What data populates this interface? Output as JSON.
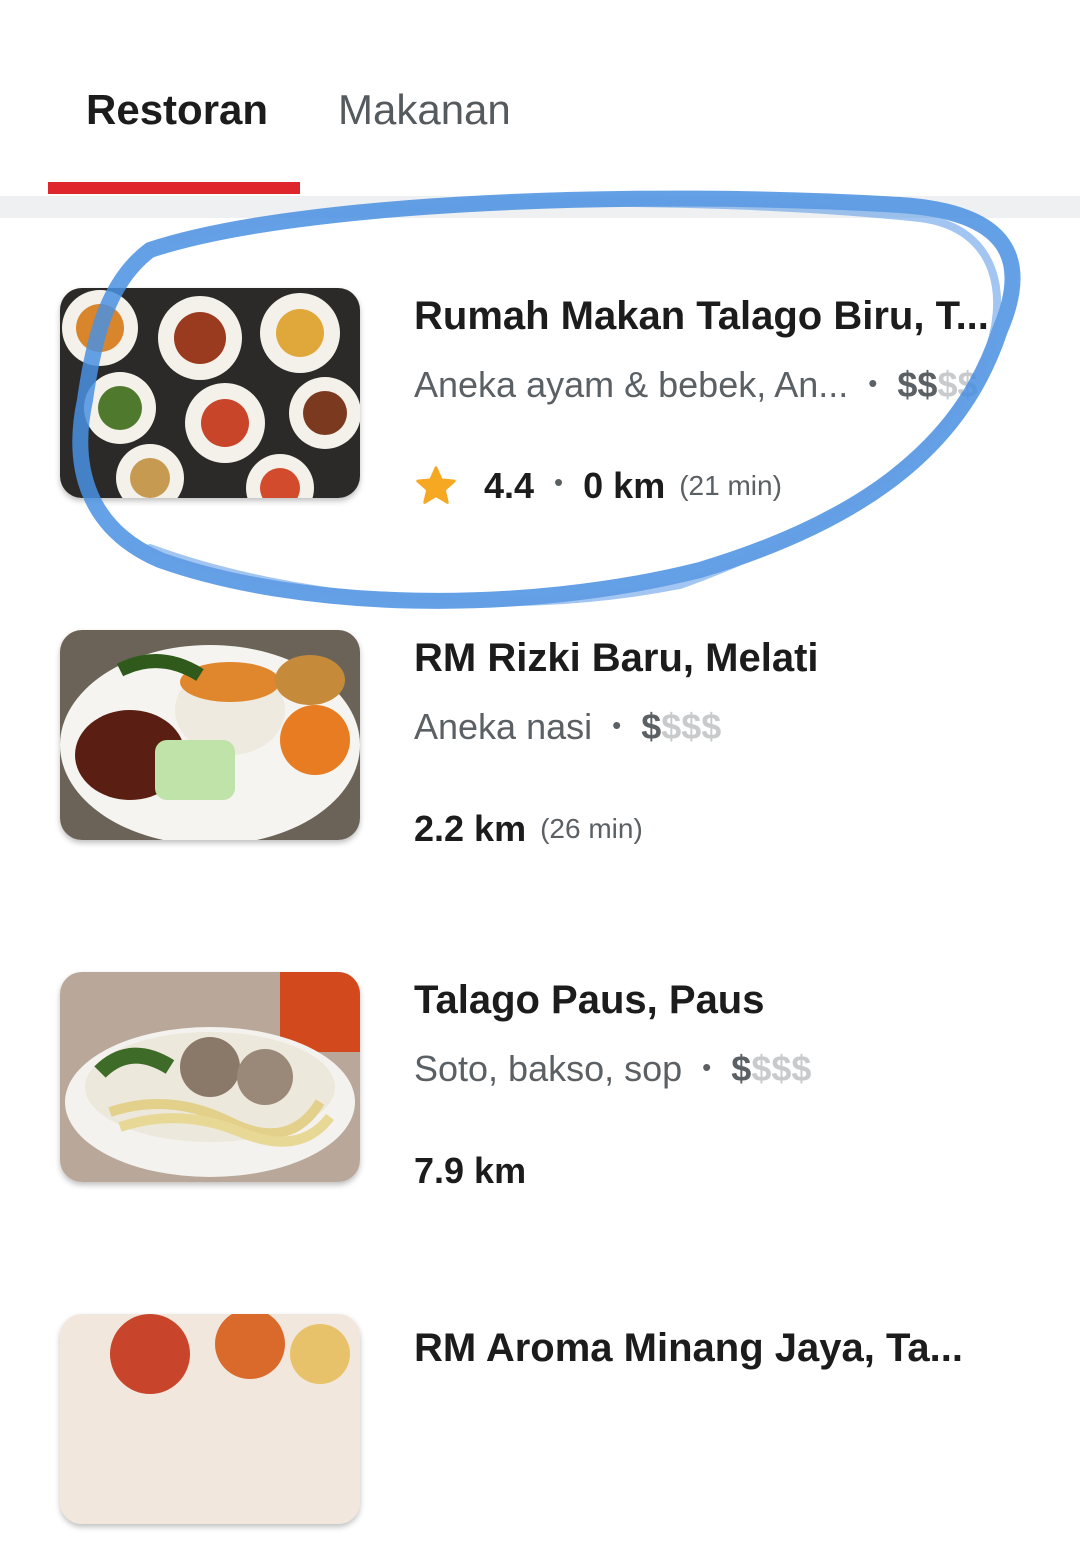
{
  "tabs": [
    {
      "label": "Restoran",
      "active": true
    },
    {
      "label": "Makanan",
      "active": false
    }
  ],
  "accent_color": "#e0262d",
  "restaurants": [
    {
      "name": "Rumah Makan Talago Biru, T...",
      "category": "Aneka ayam & bebek, An...",
      "price_active": "$$",
      "price_inactive": "$$",
      "rating": "4.4",
      "distance": "0 km",
      "eta": "(21 min)",
      "highlighted": true,
      "thumb": "padang-dishes-icon"
    },
    {
      "name": "RM Rizki Baru, Melati",
      "category": "Aneka nasi",
      "price_active": "$",
      "price_inactive": "$$$",
      "distance": "2.2 km",
      "eta": "(26 min)",
      "thumb": "rice-plate-icon"
    },
    {
      "name": "Talago Paus, Paus",
      "category": "Soto, bakso, sop",
      "price_active": "$",
      "price_inactive": "$$$",
      "distance": "7.9 km",
      "thumb": "bakso-bowl-icon"
    },
    {
      "name": "RM Aroma Minang Jaya, Ta...",
      "thumb": "food-platter-icon"
    }
  ]
}
